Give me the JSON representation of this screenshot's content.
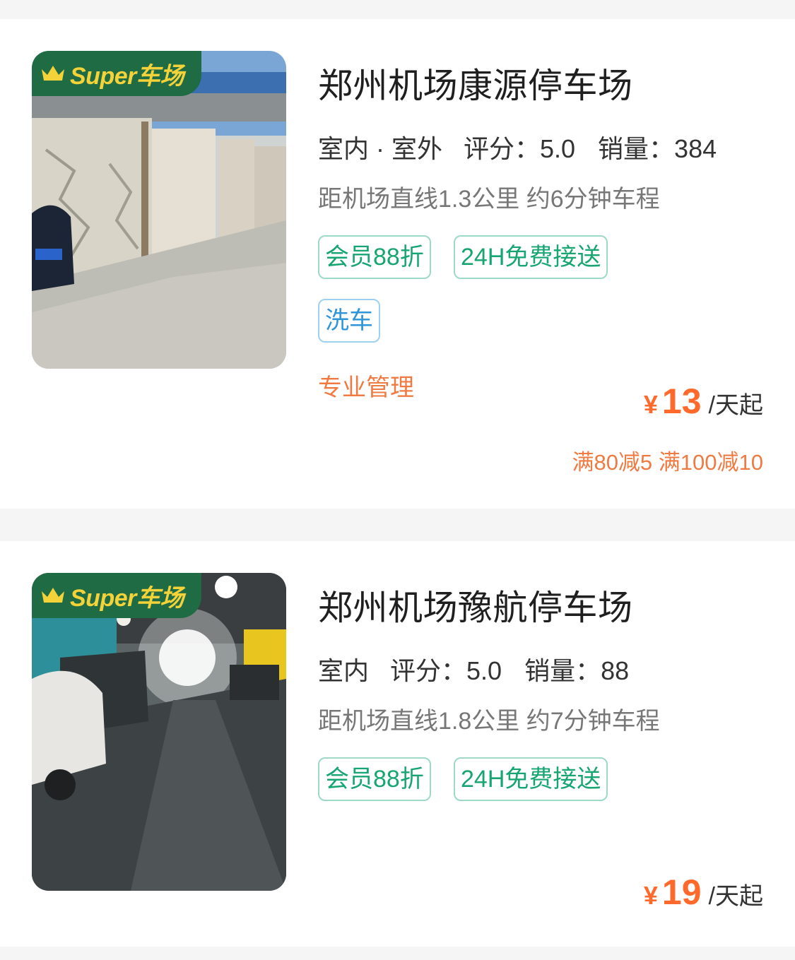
{
  "parkings": [
    {
      "badge": "Super车场",
      "title": "郑州机场康源停车场",
      "location_type": "室内 · 室外",
      "rating": "评分：5.0",
      "sales": "销量：384",
      "distance": "距机场直线1.3公里 约6分钟车程",
      "tags": [
        "会员88折",
        "24H免费接送"
      ],
      "service_tags": [
        "洗车"
      ],
      "feature": "专业管理",
      "price": {
        "currency": "¥",
        "amount": "13",
        "unit": "/天起"
      },
      "promo": "满80减5 满100减10"
    },
    {
      "badge": "Super车场",
      "title": "郑州机场豫航停车场",
      "location_type": "室内",
      "rating": "评分：5.0",
      "sales": "销量：88",
      "distance": "距机场直线1.8公里 约7分钟车程",
      "tags": [
        "会员88折",
        "24H免费接送"
      ],
      "price": {
        "currency": "¥",
        "amount": "19",
        "unit": "/天起"
      }
    }
  ],
  "colors": {
    "price": "#ff6a2c",
    "tag_green": "#17a673",
    "tag_blue": "#2d95d8",
    "badge_bg": "#1f6b43",
    "badge_text": "#f4d23a"
  }
}
